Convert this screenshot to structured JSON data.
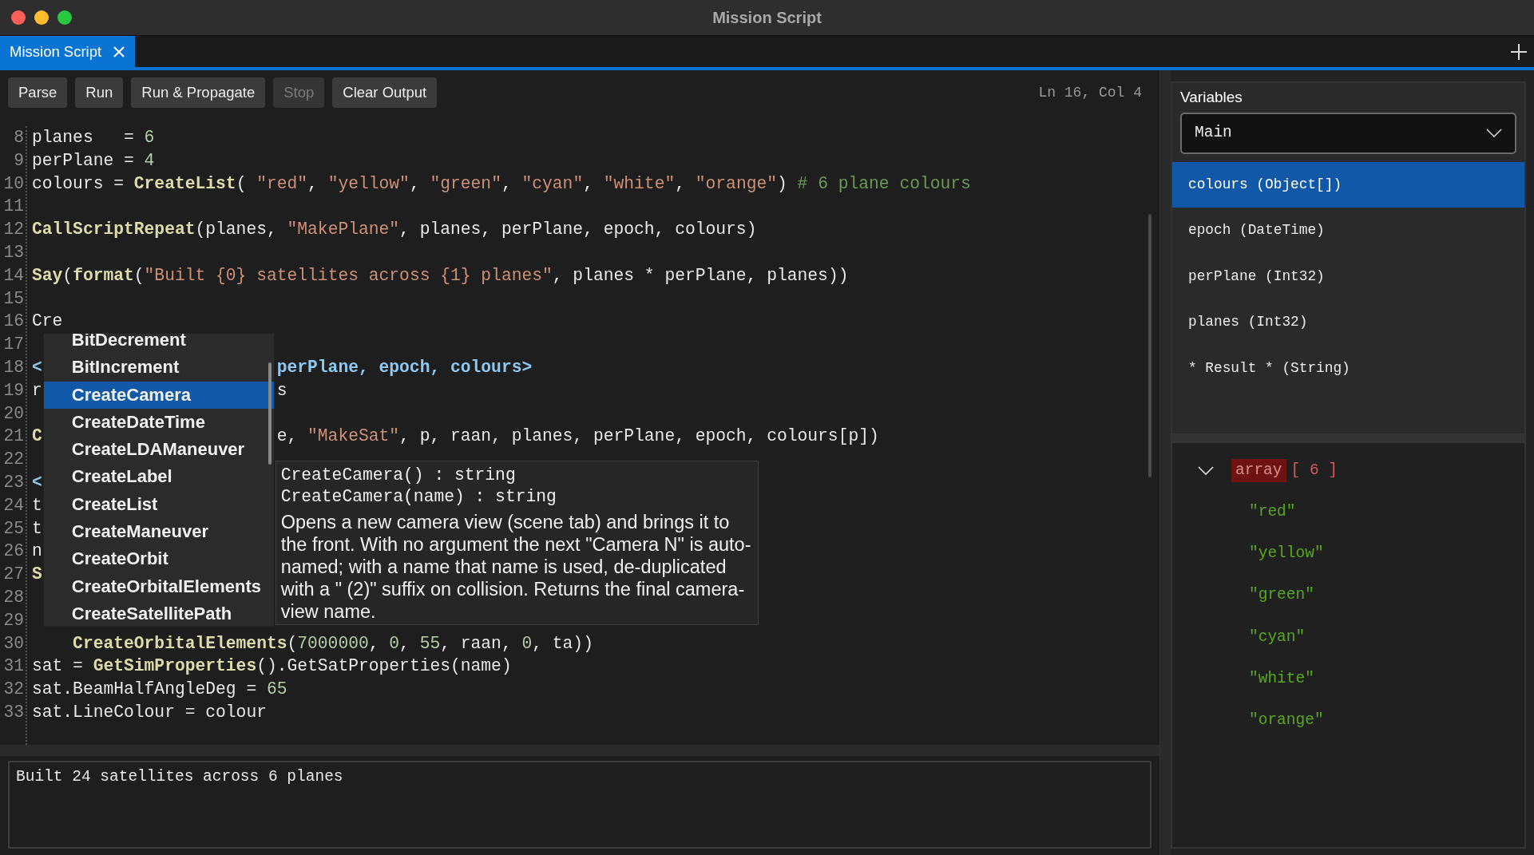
{
  "window": {
    "title": "Mission Script"
  },
  "tabs": [
    {
      "label": "Mission Script",
      "selected": true
    }
  ],
  "toolbar": {
    "buttons": [
      {
        "label": "Parse",
        "disabled": false
      },
      {
        "label": "Run",
        "disabled": false
      },
      {
        "label": "Run & Propagate",
        "disabled": false
      },
      {
        "label": "Stop",
        "disabled": true
      },
      {
        "label": "Clear Output",
        "disabled": false
      }
    ],
    "cursor_position": "Ln 16, Col 4"
  },
  "editor": {
    "lines": [
      {
        "number": "8",
        "segments": [
          {
            "text": "planes   = ",
            "kind": "plain"
          },
          {
            "text": "6",
            "kind": "number"
          }
        ]
      },
      {
        "number": "9",
        "segments": [
          {
            "text": "perPlane = ",
            "kind": "plain"
          },
          {
            "text": "4",
            "kind": "number"
          }
        ]
      },
      {
        "number": "10",
        "segments": [
          {
            "text": "colours = ",
            "kind": "plain"
          },
          {
            "text": "CreateList",
            "kind": "function"
          },
          {
            "text": "( ",
            "kind": "plain"
          },
          {
            "text": "\"red\"",
            "kind": "string"
          },
          {
            "text": ", ",
            "kind": "plain"
          },
          {
            "text": "\"yellow\"",
            "kind": "string"
          },
          {
            "text": ", ",
            "kind": "plain"
          },
          {
            "text": "\"green\"",
            "kind": "string"
          },
          {
            "text": ", ",
            "kind": "plain"
          },
          {
            "text": "\"cyan\"",
            "kind": "string"
          },
          {
            "text": ", ",
            "kind": "plain"
          },
          {
            "text": "\"white\"",
            "kind": "string"
          },
          {
            "text": ", ",
            "kind": "plain"
          },
          {
            "text": "\"orange\"",
            "kind": "string"
          },
          {
            "text": ") ",
            "kind": "plain"
          },
          {
            "text": "# 6 plane colours",
            "kind": "comment"
          }
        ]
      },
      {
        "number": "11"
      },
      {
        "number": "12",
        "segments": [
          {
            "text": "CallScriptRepeat",
            "kind": "function"
          },
          {
            "text": "(planes, ",
            "kind": "plain"
          },
          {
            "text": "\"MakePlane\"",
            "kind": "string"
          },
          {
            "text": ", planes, perPlane, epoch, colours)",
            "kind": "plain"
          }
        ]
      },
      {
        "number": "13"
      },
      {
        "number": "14",
        "segments": [
          {
            "text": "Say",
            "kind": "function"
          },
          {
            "text": "(",
            "kind": "plain"
          },
          {
            "text": "format",
            "kind": "function"
          },
          {
            "text": "(",
            "kind": "plain"
          },
          {
            "text": "\"Built {0} satellites across {1} planes\"",
            "kind": "string"
          },
          {
            "text": ", planes * perPlane, planes))",
            "kind": "plain"
          }
        ]
      },
      {
        "number": "15"
      },
      {
        "number": "16",
        "segments": [
          {
            "text": "Cre",
            "kind": "plain"
          }
        ]
      },
      {
        "number": "17"
      },
      {
        "number": "18",
        "segments": [
          {
            "text": "<",
            "kind": "tag"
          }
        ],
        "right": [
          {
            "text": "perPlane, epoch, colours>",
            "kind": "tag"
          }
        ]
      },
      {
        "number": "19",
        "segments": [
          {
            "text": "r",
            "kind": "plain"
          }
        ],
        "right": [
          {
            "text": "s",
            "kind": "plain"
          }
        ]
      },
      {
        "number": "20"
      },
      {
        "number": "21",
        "segments": [
          {
            "text": "C",
            "kind": "function"
          }
        ],
        "right": [
          {
            "text": "e, ",
            "kind": "plain"
          },
          {
            "text": "\"MakeSat\"",
            "kind": "string"
          },
          {
            "text": ", p, raan, planes, perPlane, epoch, colours[p])",
            "kind": "plain"
          }
        ]
      },
      {
        "number": "22"
      },
      {
        "number": "23",
        "segments": [
          {
            "text": "<",
            "kind": "tag"
          }
        ]
      },
      {
        "number": "24",
        "segments": [
          {
            "text": "t",
            "kind": "plain"
          }
        ]
      },
      {
        "number": "25",
        "segments": [
          {
            "text": "t",
            "kind": "plain"
          }
        ]
      },
      {
        "number": "26",
        "segments": [
          {
            "text": "n",
            "kind": "plain"
          }
        ]
      },
      {
        "number": "27",
        "segments": [
          {
            "text": "S",
            "kind": "function"
          }
        ]
      },
      {
        "number": "28"
      },
      {
        "number": "29"
      },
      {
        "number": "30",
        "indented": true,
        "segments": [
          {
            "text": "CreateOrbitalElements",
            "kind": "function"
          },
          {
            "text": "(",
            "kind": "plain"
          },
          {
            "text": "7000000",
            "kind": "number"
          },
          {
            "text": ", ",
            "kind": "plain"
          },
          {
            "text": "0",
            "kind": "number"
          },
          {
            "text": ", ",
            "kind": "plain"
          },
          {
            "text": "55",
            "kind": "number"
          },
          {
            "text": ", raan, ",
            "kind": "plain"
          },
          {
            "text": "0",
            "kind": "number"
          },
          {
            "text": ", ta))",
            "kind": "plain"
          }
        ]
      },
      {
        "number": "31",
        "segments": [
          {
            "text": "sat = ",
            "kind": "plain"
          },
          {
            "text": "GetSimProperties",
            "kind": "function"
          },
          {
            "text": "().GetSatProperties(name)",
            "kind": "plain"
          }
        ]
      },
      {
        "number": "32",
        "segments": [
          {
            "text": "sat.BeamHalfAngleDeg = ",
            "kind": "plain"
          },
          {
            "text": "65",
            "kind": "number"
          }
        ]
      },
      {
        "number": "33",
        "segments": [
          {
            "text": "sat.LineColour = colour",
            "kind": "plain"
          }
        ]
      }
    ]
  },
  "autocomplete": {
    "items": [
      {
        "label": "BitDecrement",
        "selected": false
      },
      {
        "label": "BitIncrement",
        "selected": false
      },
      {
        "label": "CreateCamera",
        "selected": true
      },
      {
        "label": "CreateDateTime",
        "selected": false
      },
      {
        "label": "CreateLDAManeuver",
        "selected": false
      },
      {
        "label": "CreateLabel",
        "selected": false
      },
      {
        "label": "CreateList",
        "selected": false
      },
      {
        "label": "CreateManeuver",
        "selected": false
      },
      {
        "label": "CreateOrbit",
        "selected": false
      },
      {
        "label": "CreateOrbitalElements",
        "selected": false
      },
      {
        "label": "CreateSatellitePath",
        "selected": false
      }
    ]
  },
  "tooltip": {
    "signatures": [
      "CreateCamera() : string",
      "CreateCamera(name) : string"
    ],
    "description": "Opens a new camera view (scene tab) and brings it to the front. With no argument the next \"Camera N\" is auto-named; with a name that name is used, de-duplicated with a \" (2)\" suffix on collision. Returns the final camera-view name."
  },
  "output": {
    "text": "Built 24 satellites across 6 planes"
  },
  "variables": {
    "title": "Variables",
    "scope": "Main",
    "items": [
      {
        "label": "colours (Object[])",
        "selected": true
      },
      {
        "label": "epoch (DateTime)",
        "selected": false
      },
      {
        "label": "perPlane (Int32)",
        "selected": false
      },
      {
        "label": "planes (Int32)",
        "selected": false
      },
      {
        "label": "* Result * (String)",
        "selected": false
      }
    ],
    "inspector": {
      "type": "array",
      "count": "[ 6 ]",
      "expanded": true,
      "children": [
        "\"red\"",
        "\"yellow\"",
        "\"green\"",
        "\"cyan\"",
        "\"white\"",
        "\"orange\""
      ]
    }
  }
}
